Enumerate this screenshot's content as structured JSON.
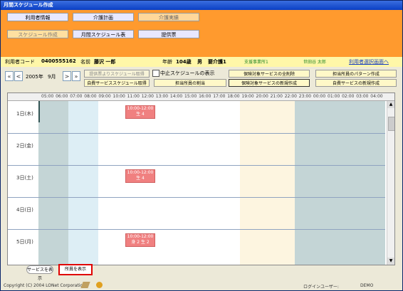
{
  "window": {
    "title": "月間スケジュール作成"
  },
  "nav": {
    "row1": [
      "利用者情報",
      "介護計画",
      "介護実績"
    ],
    "row2": [
      "スケジュール作成",
      "月間スケジュール表",
      "提供票"
    ]
  },
  "user": {
    "code_label": "利用者コード",
    "code": "0400555162",
    "name_label": "名前",
    "name": "藤沢 一郎",
    "age_label": "年齢",
    "age": "104歳",
    "gender": "男",
    "care_level": "要介護1",
    "office": "支援事業所1",
    "staff": "世田谷 太郎",
    "select_link": "利用者選択画面へ"
  },
  "month": {
    "year_label": "2005年",
    "month_label": "9月"
  },
  "controls": {
    "from_provide": "提供票よりスケジュール取得",
    "self_service": "自費サービススケジュール取得",
    "show_cancel": "中止スケジュールの表示",
    "delete_all": "保険対象サービスの全削除",
    "pattern": "担当所員のパターン作成",
    "assign": "担当所員の割当",
    "new_insured": "保険対象サービスの新規作成",
    "new_self": "自費サービスの新規作成"
  },
  "hours": [
    "05:00",
    "06:00",
    "07:00",
    "08:00",
    "09:00",
    "10:00",
    "11:00",
    "12:00",
    "13:00",
    "14:00",
    "15:00",
    "16:00",
    "17:00",
    "18:00",
    "19:00",
    "20:00",
    "21:00",
    "22:00",
    "23:00",
    "00:00",
    "01:00",
    "02:00",
    "03:00",
    "04:00"
  ],
  "days": [
    {
      "label": "1日(木)",
      "event_time": "10:00-12:00",
      "event_text": "生 4"
    },
    {
      "label": "2日(金)"
    },
    {
      "label": "3日(土)",
      "event_time": "10:00-12:00",
      "event_text": "生 4"
    },
    {
      "label": "4日(日)"
    },
    {
      "label": "5日(月)",
      "event_time": "10:00-12:00",
      "event_text": "身 2 生 2"
    }
  ],
  "bottom": {
    "show_service": "サービスを表示",
    "show_staff": "所員を表示"
  },
  "footer": {
    "copyright": "Copyright (C) 2004 LONet Corporation",
    "login_label": "ログインユーザー:",
    "login_user": "DEMO"
  }
}
